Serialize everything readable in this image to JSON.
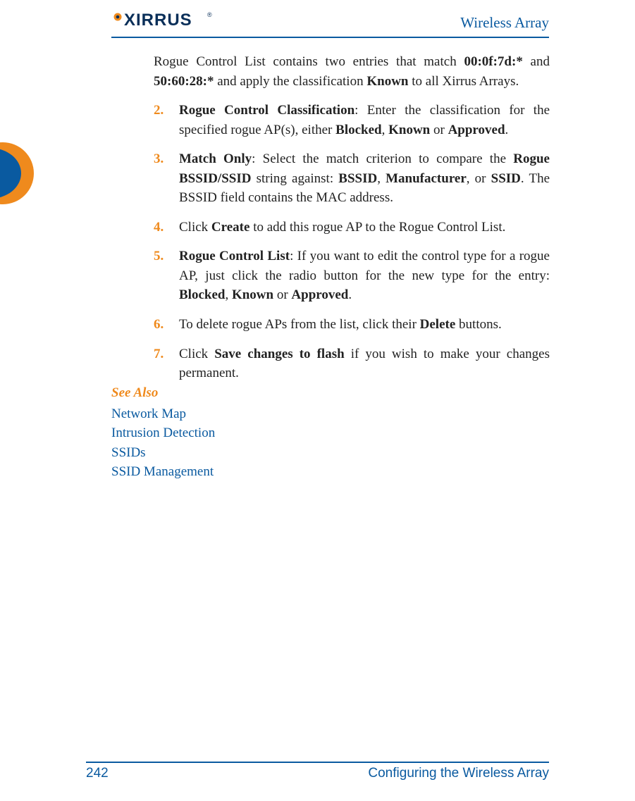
{
  "header": {
    "product": "Wireless Array",
    "logo_text": "XIRRUS",
    "logo_r": "®"
  },
  "intro": {
    "pre": "Rogue Control List contains two entries that match ",
    "mac1": "00:0f:7d:*",
    "mid1": " and ",
    "mac2": "50:60:28:*",
    "mid2": " and apply the classification ",
    "known": "Known",
    "post": " to all Xirrus Arrays."
  },
  "steps": {
    "s2": {
      "num": "2.",
      "title": "Rogue Control Classification",
      "t1": ": Enter the classification for the specified rogue AP(s), either ",
      "b1": "Blocked",
      "c1": ", ",
      "b2": "Known",
      "c2": " or ",
      "b3": "Approved",
      "end": "."
    },
    "s3": {
      "num": "3.",
      "title": "Match Only",
      "t1": ": Select the match criterion to compare the ",
      "b1": "Rogue BSSID/SSID",
      "t2": " string against: ",
      "b2": "BSSID",
      "c1": ", ",
      "b3": "Manufacturer",
      "c2": ", or ",
      "b4": "SSID",
      "t3": ". The BSSID field contains the MAC address."
    },
    "s4": {
      "num": "4.",
      "t1": "Click ",
      "b1": "Create",
      "t2": " to add this rogue AP to the Rogue Control List."
    },
    "s5": {
      "num": "5.",
      "title": "Rogue Control List",
      "t1": ": If you want to edit the control type for a rogue AP, just click the radio button for the new type for the entry: ",
      "b1": "Blocked",
      "c1": ", ",
      "b2": "Known",
      "c2": " or ",
      "b3": "Approved",
      "end": "."
    },
    "s6": {
      "num": "6.",
      "t1": "To delete rogue APs from the list, click their ",
      "b1": "Delete",
      "t2": " buttons."
    },
    "s7": {
      "num": "7.",
      "t1": "Click ",
      "b1": "Save changes to flash",
      "t2": " if you wish to make your changes permanent."
    }
  },
  "see_also": {
    "heading": "See Also",
    "links": [
      "Network Map",
      "Intrusion Detection",
      "SSIDs",
      "SSID Management"
    ]
  },
  "footer": {
    "page": "242",
    "section": "Configuring the Wireless Array"
  }
}
